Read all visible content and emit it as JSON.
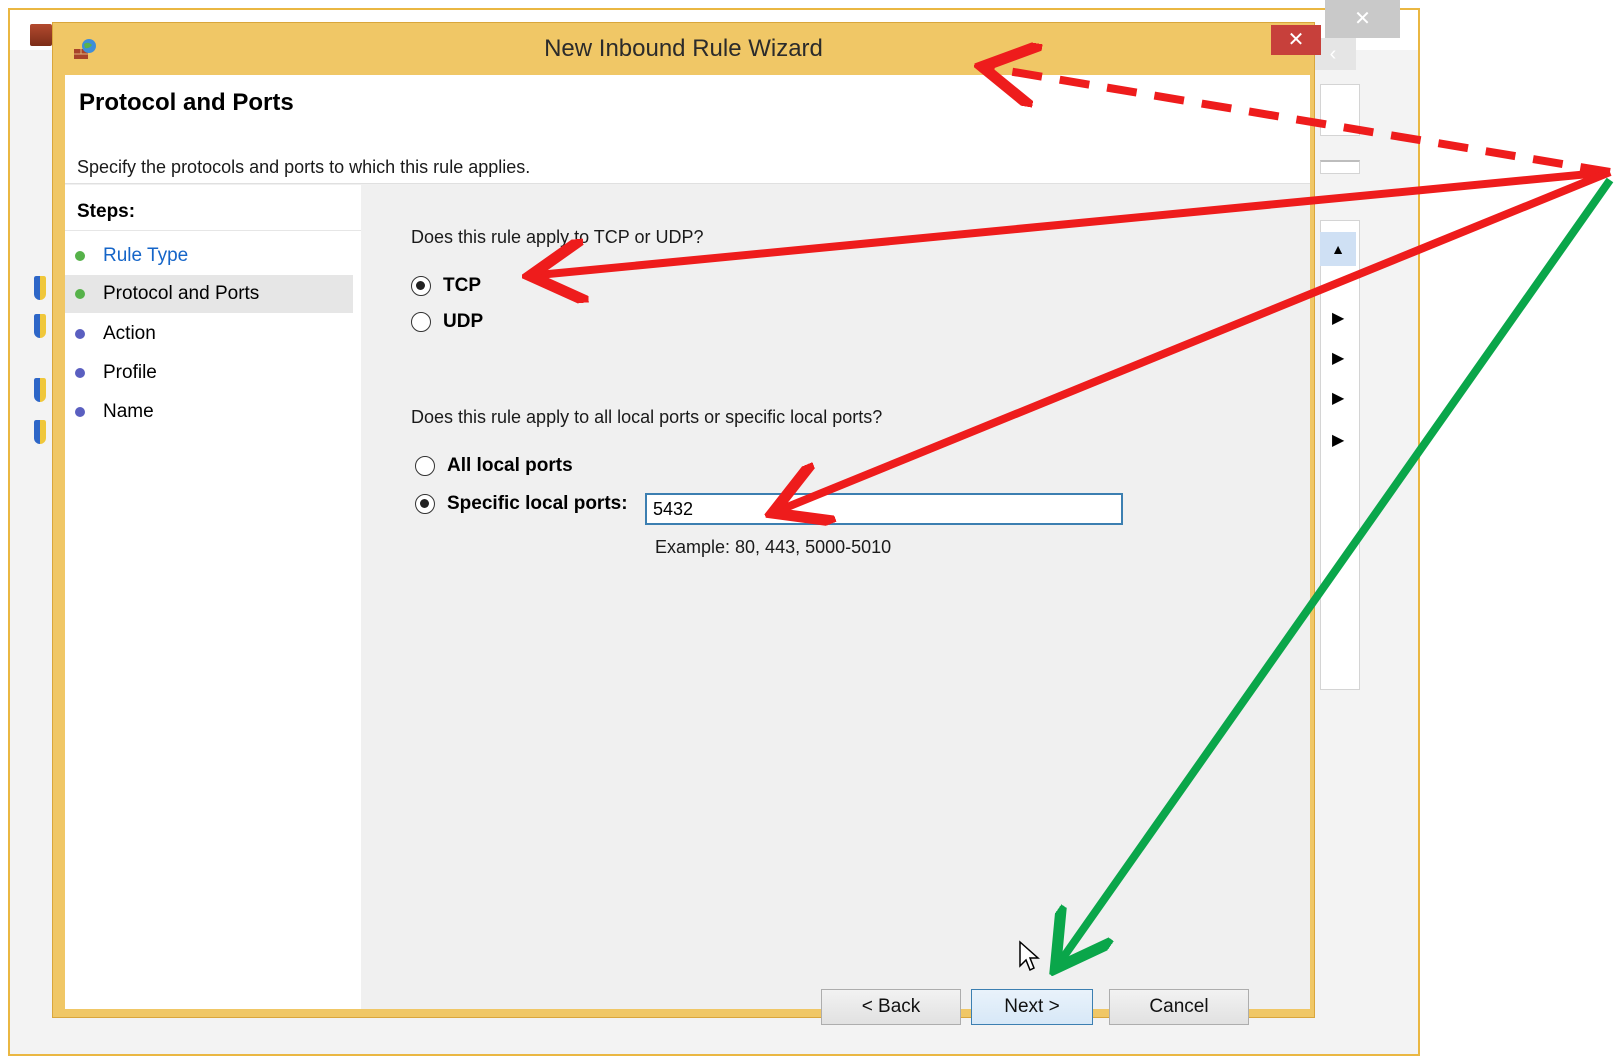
{
  "dialog": {
    "title": "New Inbound Rule Wizard",
    "close_glyph": "✕",
    "header_title": "Protocol and Ports",
    "header_subtitle": "Specify the protocols and ports to which this rule applies."
  },
  "background_window": {
    "close_glyph": "✕",
    "back_glyph": "‹"
  },
  "steps": {
    "title": "Steps:",
    "items": [
      {
        "label": "Rule Type",
        "status": "link",
        "bullet_color": "#56b24a"
      },
      {
        "label": "Protocol and Ports",
        "status": "current",
        "bullet_color": "#56b24a"
      },
      {
        "label": "Action",
        "status": "pending",
        "bullet_color": "#5a5fc0"
      },
      {
        "label": "Profile",
        "status": "pending",
        "bullet_color": "#5a5fc0"
      },
      {
        "label": "Name",
        "status": "pending",
        "bullet_color": "#5a5fc0"
      }
    ]
  },
  "protocol": {
    "question": "Does this rule apply to TCP or UDP?",
    "options": [
      {
        "label": "TCP",
        "checked": true
      },
      {
        "label": "UDP",
        "checked": false
      }
    ]
  },
  "ports": {
    "question": "Does this rule apply to all local ports or specific local ports?",
    "options": [
      {
        "label": "All local ports",
        "checked": false
      },
      {
        "label": "Specific local ports:",
        "checked": true
      }
    ],
    "value": "5432",
    "example": "Example: 80, 443, 5000-5010"
  },
  "buttons": {
    "back": "< Back",
    "next": "Next >",
    "cancel": "Cancel"
  },
  "colors": {
    "dialog_frame": "#f0c766",
    "close_button": "#c7403b",
    "link": "#1565c8",
    "annotation_red": "#ee1c1c",
    "annotation_green": "#0aa64a"
  },
  "icons": {
    "title": "firewall-globe-icon",
    "background_app": "firewall-icon",
    "step_bullet": "bullet-icon",
    "cursor": "mouse-pointer-icon"
  }
}
